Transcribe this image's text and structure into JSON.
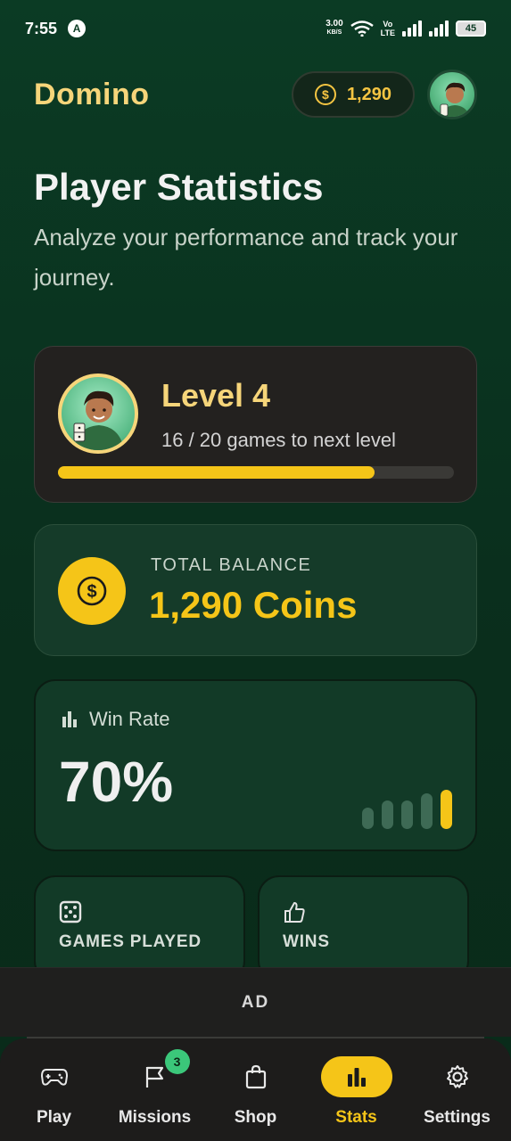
{
  "status_bar": {
    "time": "7:55",
    "net_speed_value": "3.00",
    "net_speed_unit": "KB/S",
    "volte_top": "Vo",
    "volte_bottom": "LTE",
    "battery": "45"
  },
  "header": {
    "brand": "Domino",
    "coin_balance": "1,290"
  },
  "page": {
    "title": "Player Statistics",
    "subtitle": "Analyze your performance and track your journey."
  },
  "level_card": {
    "level": "Level 4",
    "progress_text": "16 / 20 games to next level",
    "progress_fraction": 0.8
  },
  "balance_card": {
    "label": "TOTAL BALANCE",
    "value": "1,290 Coins"
  },
  "winrate_card": {
    "label": "Win Rate",
    "value": "70%"
  },
  "stat_cards": [
    {
      "label": "GAMES PLAYED",
      "icon": "dice-icon"
    },
    {
      "label": "WINS",
      "icon": "thumbs-up-icon"
    }
  ],
  "ad": {
    "label": "AD"
  },
  "nav": {
    "items": [
      {
        "label": "Play",
        "icon": "gamepad-icon"
      },
      {
        "label": "Missions",
        "icon": "flag-icon",
        "badge": "3"
      },
      {
        "label": "Shop",
        "icon": "shopping-bag-icon"
      },
      {
        "label": "Stats",
        "icon": "bar-chart-icon",
        "active": true
      },
      {
        "label": "Settings",
        "icon": "gear-icon"
      }
    ]
  },
  "colors": {
    "accent": "#f5c518",
    "brand": "#f6d57a",
    "background": "#0b3b24",
    "badge": "#3bc77a"
  }
}
